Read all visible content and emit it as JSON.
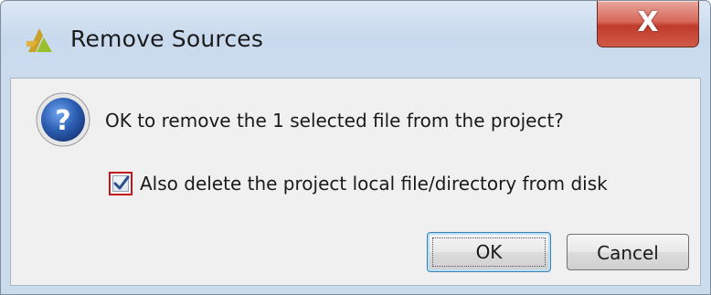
{
  "window": {
    "title": "Remove Sources",
    "close_label": "X"
  },
  "icons": {
    "app": "vivado-logo-icon",
    "question": "question-icon",
    "check": "checkmark-icon"
  },
  "dialog": {
    "message": "OK to remove the 1 selected file from the project?",
    "delete_checkbox": {
      "label": "Also delete the project local file/directory from disk",
      "checked": true
    },
    "ok_label": "OK",
    "cancel_label": "Cancel"
  },
  "colors": {
    "checkbox_highlight": "#c4161c",
    "question_icon": "#2d5fb3",
    "close_button": "#c03b2b"
  }
}
